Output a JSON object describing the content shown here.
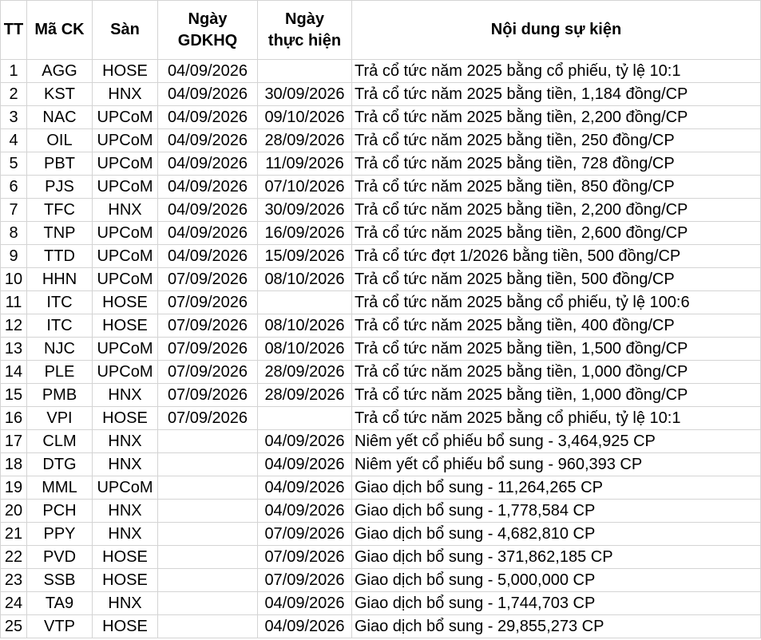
{
  "headers": {
    "tt": "TT",
    "ma_ck": "Mã CK",
    "san": "Sàn",
    "gdkhq_line1": "Ngày",
    "gdkhq_line2": "GDKHQ",
    "thuc_hien_line1": "Ngày",
    "thuc_hien_line2": "thực hiện",
    "noi_dung": "Nội dung sự kiện"
  },
  "rows": [
    {
      "tt": "1",
      "ma": "AGG",
      "san": "HOSE",
      "gdkhq": "04/09/2026",
      "thuc_hien": "",
      "noi_dung": "Trả cổ tức năm 2025 bằng cổ phiếu, tỷ lệ 10:1"
    },
    {
      "tt": "2",
      "ma": "KST",
      "san": "HNX",
      "gdkhq": "04/09/2026",
      "thuc_hien": "30/09/2026",
      "noi_dung": "Trả cổ tức năm 2025 bằng tiền, 1,184 đồng/CP"
    },
    {
      "tt": "3",
      "ma": "NAC",
      "san": "UPCoM",
      "gdkhq": "04/09/2026",
      "thuc_hien": "09/10/2026",
      "noi_dung": "Trả cổ tức năm 2025 bằng tiền, 2,200 đồng/CP"
    },
    {
      "tt": "4",
      "ma": "OIL",
      "san": "UPCoM",
      "gdkhq": "04/09/2026",
      "thuc_hien": "28/09/2026",
      "noi_dung": "Trả cổ tức năm 2025 bằng tiền, 250 đồng/CP"
    },
    {
      "tt": "5",
      "ma": "PBT",
      "san": "UPCoM",
      "gdkhq": "04/09/2026",
      "thuc_hien": "11/09/2026",
      "noi_dung": "Trả cổ tức năm 2025 bằng tiền, 728 đồng/CP"
    },
    {
      "tt": "6",
      "ma": "PJS",
      "san": "UPCoM",
      "gdkhq": "04/09/2026",
      "thuc_hien": "07/10/2026",
      "noi_dung": "Trả cổ tức năm 2025 bằng tiền, 850 đồng/CP"
    },
    {
      "tt": "7",
      "ma": "TFC",
      "san": "HNX",
      "gdkhq": "04/09/2026",
      "thuc_hien": "30/09/2026",
      "noi_dung": "Trả cổ tức năm 2025 bằng tiền, 2,200 đồng/CP"
    },
    {
      "tt": "8",
      "ma": "TNP",
      "san": "UPCoM",
      "gdkhq": "04/09/2026",
      "thuc_hien": "16/09/2026",
      "noi_dung": "Trả cổ tức năm 2025 bằng tiền, 2,600 đồng/CP"
    },
    {
      "tt": "9",
      "ma": "TTD",
      "san": "UPCoM",
      "gdkhq": "04/09/2026",
      "thuc_hien": "15/09/2026",
      "noi_dung": "Trả cổ tức đợt 1/2026 bằng tiền, 500 đồng/CP"
    },
    {
      "tt": "10",
      "ma": "HHN",
      "san": "UPCoM",
      "gdkhq": "07/09/2026",
      "thuc_hien": "08/10/2026",
      "noi_dung": "Trả cổ tức năm 2025 bằng tiền, 500 đồng/CP"
    },
    {
      "tt": "11",
      "ma": "ITC",
      "san": "HOSE",
      "gdkhq": "07/09/2026",
      "thuc_hien": "",
      "noi_dung": "Trả cổ tức năm 2025 bằng cổ phiếu, tỷ lệ 100:6"
    },
    {
      "tt": "12",
      "ma": "ITC",
      "san": "HOSE",
      "gdkhq": "07/09/2026",
      "thuc_hien": "08/10/2026",
      "noi_dung": "Trả cổ tức năm 2025 bằng tiền, 400 đồng/CP"
    },
    {
      "tt": "13",
      "ma": "NJC",
      "san": "UPCoM",
      "gdkhq": "07/09/2026",
      "thuc_hien": "08/10/2026",
      "noi_dung": "Trả cổ tức năm 2025 bằng tiền, 1,500 đồng/CP"
    },
    {
      "tt": "14",
      "ma": "PLE",
      "san": "UPCoM",
      "gdkhq": "07/09/2026",
      "thuc_hien": "28/09/2026",
      "noi_dung": "Trả cổ tức năm 2025 bằng tiền, 1,000 đồng/CP"
    },
    {
      "tt": "15",
      "ma": "PMB",
      "san": "HNX",
      "gdkhq": "07/09/2026",
      "thuc_hien": "28/09/2026",
      "noi_dung": "Trả cổ tức năm 2025 bằng tiền, 1,000 đồng/CP"
    },
    {
      "tt": "16",
      "ma": "VPI",
      "san": "HOSE",
      "gdkhq": "07/09/2026",
      "thuc_hien": "",
      "noi_dung": "Trả cổ tức năm 2025 bằng cổ phiếu, tỷ lệ 10:1"
    },
    {
      "tt": "17",
      "ma": "CLM",
      "san": "HNX",
      "gdkhq": "",
      "thuc_hien": "04/09/2026",
      "noi_dung": "Niêm yết cổ phiếu bổ sung - 3,464,925 CP"
    },
    {
      "tt": "18",
      "ma": "DTG",
      "san": "HNX",
      "gdkhq": "",
      "thuc_hien": "04/09/2026",
      "noi_dung": "Niêm yết cổ phiếu bổ sung - 960,393 CP"
    },
    {
      "tt": "19",
      "ma": "MML",
      "san": "UPCoM",
      "gdkhq": "",
      "thuc_hien": "04/09/2026",
      "noi_dung": "Giao dịch bổ sung - 11,264,265 CP"
    },
    {
      "tt": "20",
      "ma": "PCH",
      "san": "HNX",
      "gdkhq": "",
      "thuc_hien": "04/09/2026",
      "noi_dung": "Giao dịch bổ sung - 1,778,584 CP"
    },
    {
      "tt": "21",
      "ma": "PPY",
      "san": "HNX",
      "gdkhq": "",
      "thuc_hien": "07/09/2026",
      "noi_dung": "Giao dịch bổ sung - 4,682,810 CP"
    },
    {
      "tt": "22",
      "ma": "PVD",
      "san": "HOSE",
      "gdkhq": "",
      "thuc_hien": "07/09/2026",
      "noi_dung": "Giao dịch bổ sung - 371,862,185 CP"
    },
    {
      "tt": "23",
      "ma": "SSB",
      "san": "HOSE",
      "gdkhq": "",
      "thuc_hien": "07/09/2026",
      "noi_dung": "Giao dịch bổ sung - 5,000,000 CP"
    },
    {
      "tt": "24",
      "ma": "TA9",
      "san": "HNX",
      "gdkhq": "",
      "thuc_hien": "04/09/2026",
      "noi_dung": "Giao dịch bổ sung - 1,744,703 CP"
    },
    {
      "tt": "25",
      "ma": "VTP",
      "san": "HOSE",
      "gdkhq": "",
      "thuc_hien": "04/09/2026",
      "noi_dung": "Giao dịch bổ sung - 29,855,273 CP"
    }
  ]
}
